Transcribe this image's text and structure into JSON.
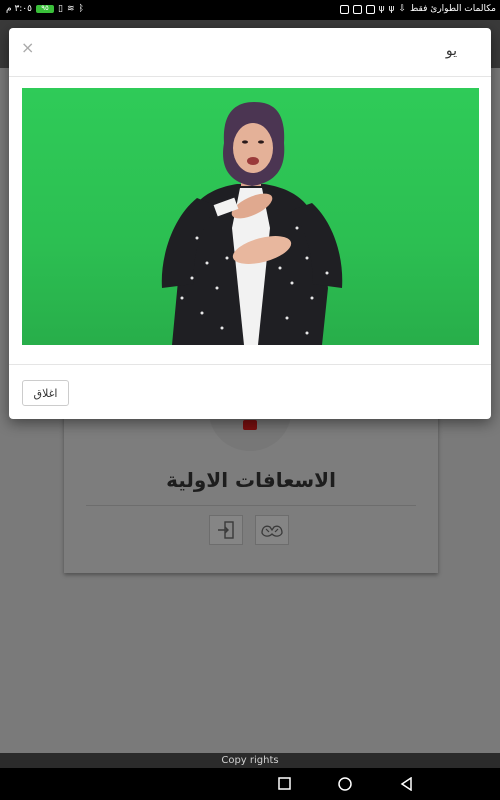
{
  "status_bar": {
    "carrier_text": "مكالمات الطوارئ فقط",
    "time": "٣:٠٥ م",
    "battery": "٩٥"
  },
  "menu": {
    "icon": "hamburger-icon"
  },
  "page": {
    "card_title": "الاسعافات الاولية",
    "card_buttons": [
      {
        "icon": "sign-language-hands-icon"
      },
      {
        "icon": "enter-door-icon"
      }
    ]
  },
  "footer": {
    "text": "Copy rights"
  },
  "modal": {
    "title": "يو",
    "close_symbol": "×",
    "close_button_label": "اغلاق",
    "video": {
      "background_color": "#2fcb58",
      "content": "sign-language-interpreter-video"
    }
  },
  "navbar": {
    "icons": [
      "recent-apps-icon",
      "home-icon",
      "back-icon"
    ]
  }
}
